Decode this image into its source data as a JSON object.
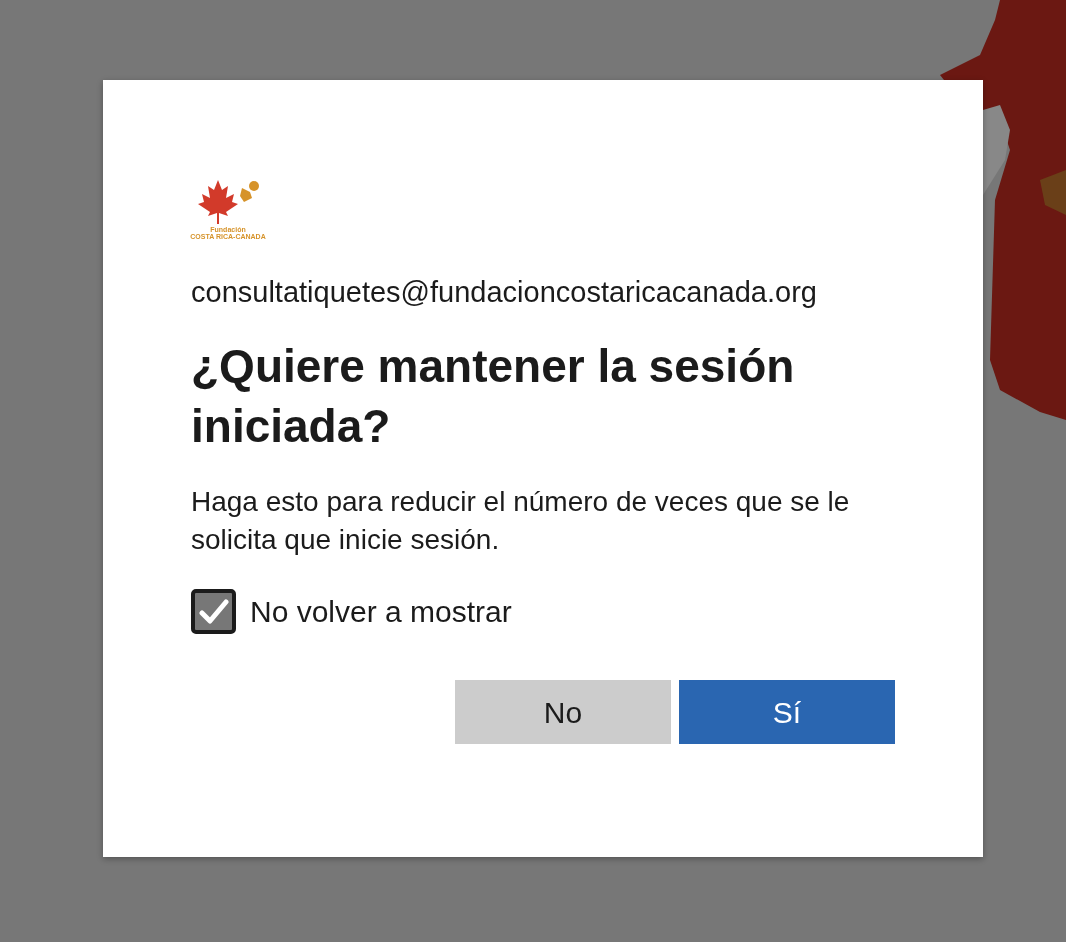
{
  "logo": {
    "line_1": "Fundación",
    "line_2": "COSTA RICA-CANADA"
  },
  "account": "consultatiquetes@fundacioncostaricacanada.org",
  "title": "¿Quiere mantener la sesión iniciada?",
  "description": "Haga esto para reducir el número de veces que se le solicita que inicie sesión.",
  "checkbox": {
    "label": "No volver a mostrar",
    "checked": true
  },
  "buttons": [
    {
      "label": "No",
      "kind": "secondary"
    },
    {
      "label": "Sí",
      "kind": "primary"
    }
  ]
}
